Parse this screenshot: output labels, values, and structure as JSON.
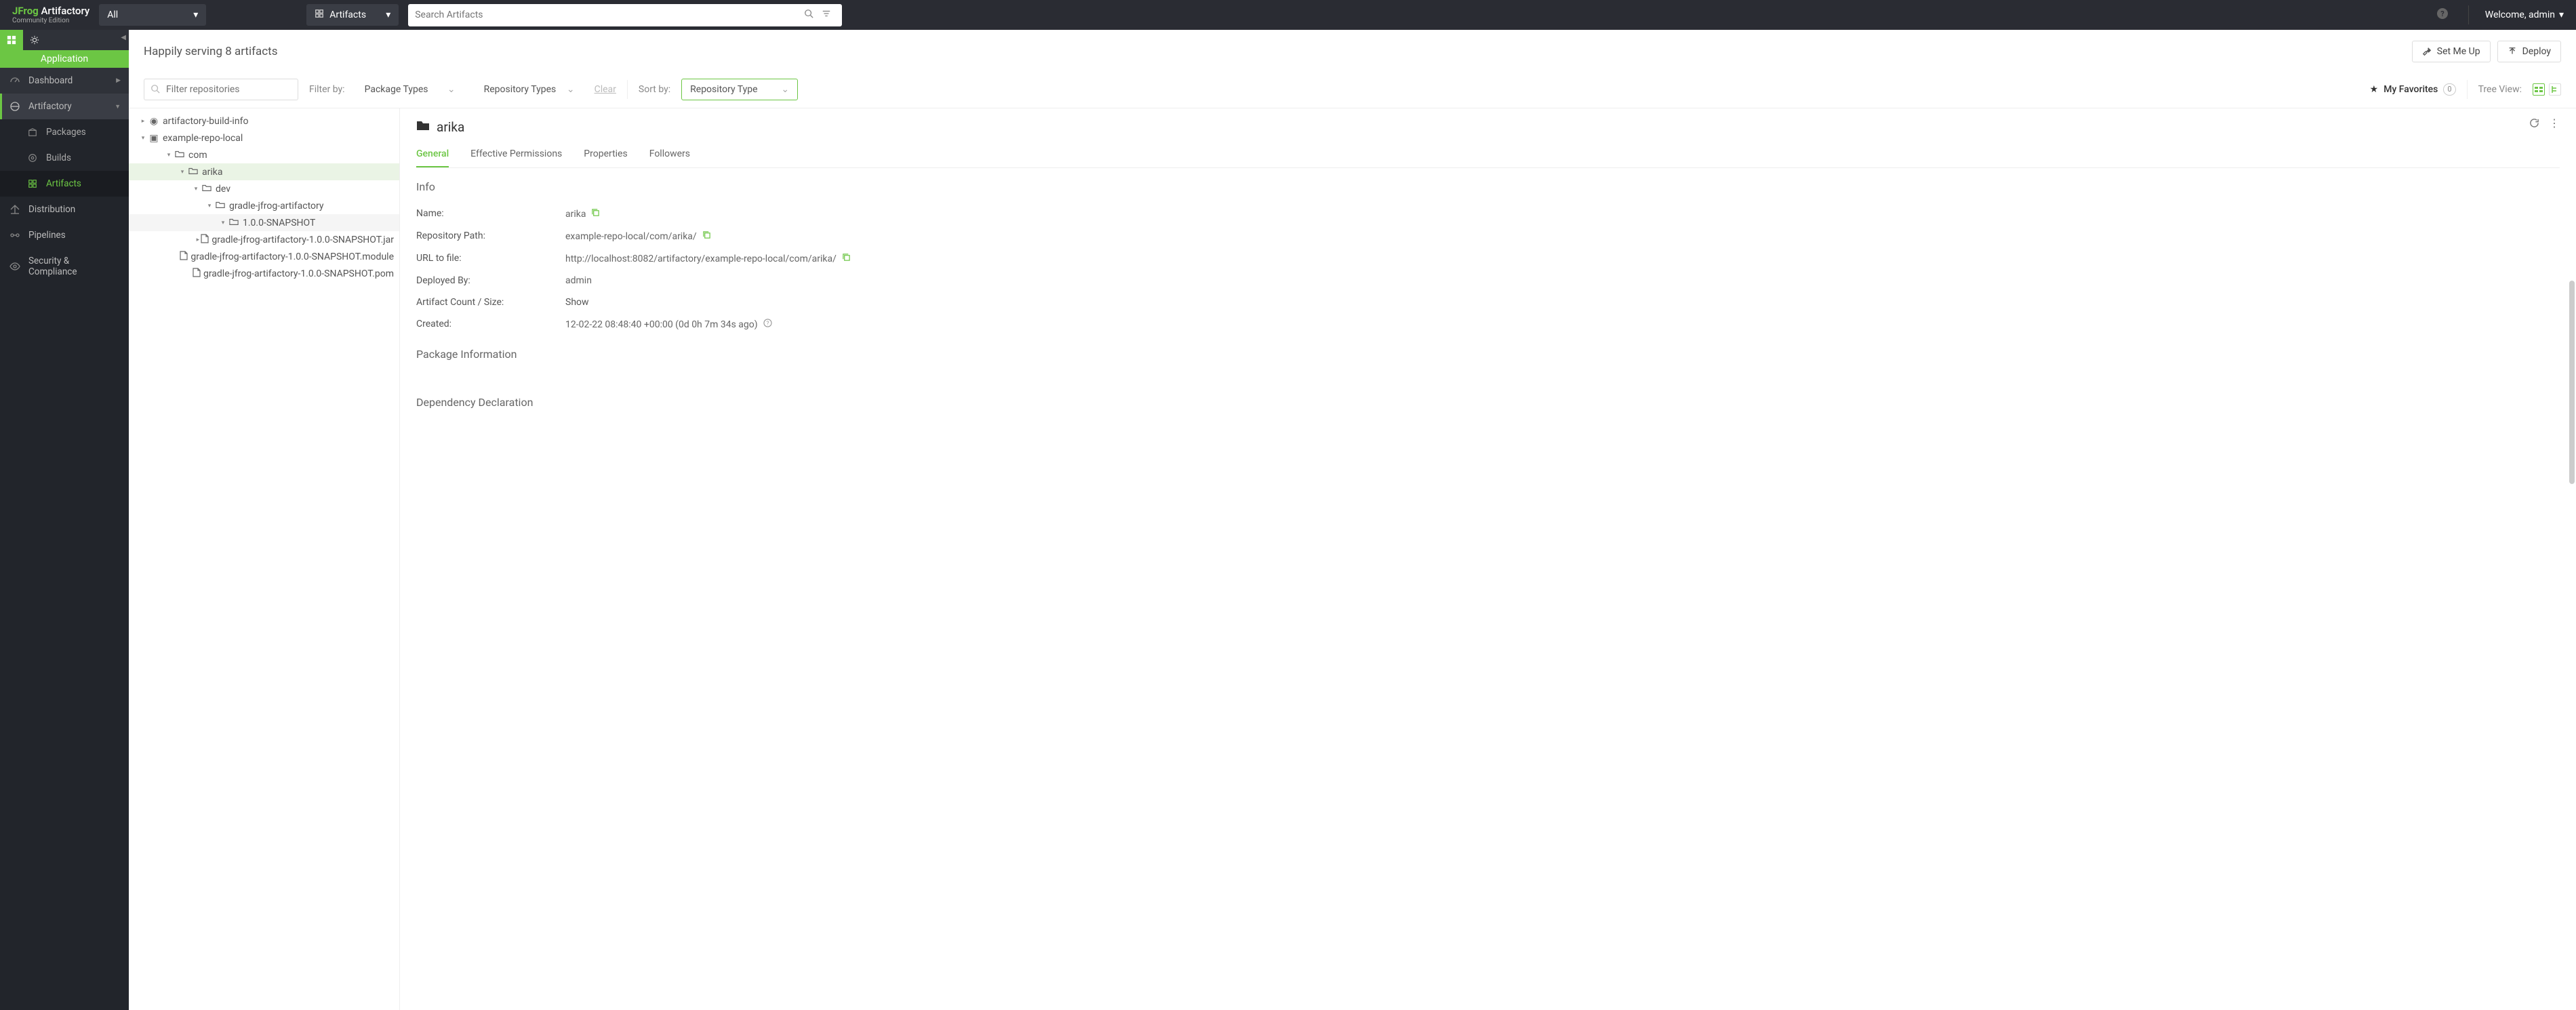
{
  "brand": {
    "j": "JFrog",
    "product": "Artifactory",
    "edition": "Community Edition"
  },
  "topbar": {
    "scope_all": "All",
    "scope_artifacts": "Artifacts",
    "search_placeholder": "Search Artifacts",
    "welcome": "Welcome, admin"
  },
  "sidebar": {
    "heading": "Application",
    "items": {
      "dashboard": "Dashboard",
      "artifactory": "Artifactory",
      "packages": "Packages",
      "builds": "Builds",
      "artifacts": "Artifacts",
      "distribution": "Distribution",
      "pipelines": "Pipelines",
      "security": "Security & Compliance"
    }
  },
  "page": {
    "title": "Happily serving 8 artifacts",
    "setmeup": "Set Me Up",
    "deploy": "Deploy"
  },
  "filters": {
    "placeholder": "Filter repositories",
    "filter_by": "Filter by:",
    "package_types": "Package Types",
    "repo_types": "Repository Types",
    "clear": "Clear",
    "sort_by": "Sort by:",
    "sort_value": "Repository Type",
    "my_favorites": "My Favorites",
    "fav_count": "0",
    "tree_view": "Tree View:"
  },
  "tree": {
    "n0": "artifactory-build-info",
    "n1": "example-repo-local",
    "n2": "com",
    "n3": "arika",
    "n4": "dev",
    "n5": "gradle-jfrog-artifactory",
    "n6": "1.0.0-SNAPSHOT",
    "n7": "gradle-jfrog-artifactory-1.0.0-SNAPSHOT.jar",
    "n8": "gradle-jfrog-artifactory-1.0.0-SNAPSHOT.module",
    "n9": "gradle-jfrog-artifactory-1.0.0-SNAPSHOT.pom"
  },
  "detail": {
    "title": "arika",
    "tabs": {
      "general": "General",
      "perms": "Effective Permissions",
      "props": "Properties",
      "followers": "Followers"
    },
    "section_info": "Info",
    "rows": {
      "name_k": "Name:",
      "name_v": "arika",
      "repo_k": "Repository Path:",
      "repo_v": "example-repo-local/com/arika/",
      "url_k": "URL to file:",
      "url_v": "http://localhost:8082/artifactory/example-repo-local/com/arika/",
      "dep_k": "Deployed By:",
      "dep_v": "admin",
      "count_k": "Artifact Count / Size:",
      "count_v": "Show",
      "created_k": "Created:",
      "created_v": "12-02-22 08:48:40 +00:00 (0d 0h 7m 34s ago)"
    },
    "section_pkg": "Package Information",
    "section_dep": "Dependency Declaration"
  }
}
